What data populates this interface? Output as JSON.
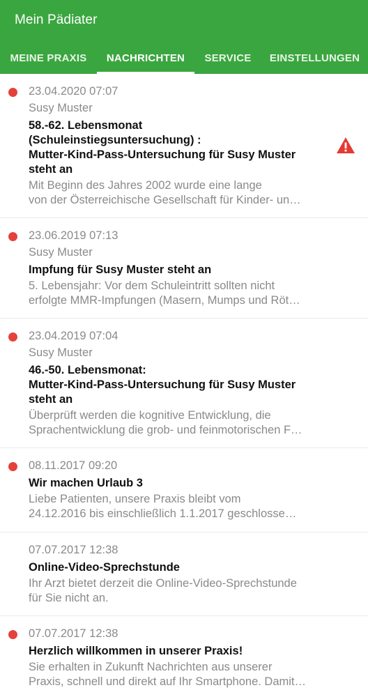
{
  "app": {
    "title": "Mein Pädiater"
  },
  "tabs": [
    {
      "label": "MEINE PRAXIS",
      "active": false
    },
    {
      "label": "NACHRICHTEN",
      "active": true
    },
    {
      "label": "SERVICE",
      "active": false
    },
    {
      "label": "EINSTELLUNGEN",
      "active": false
    }
  ],
  "colors": {
    "app_bar": "#3aa63f",
    "unread_dot": "#e5413c",
    "warning_icon": "#e53935"
  },
  "messages": [
    {
      "unread": true,
      "date": "23.04.2020 07:07",
      "sender": "Susy Muster",
      "subject": [
        "58.-62. Lebensmonat",
        "(Schuleinstiegsuntersuchung)  :",
        "Mutter-Kind-Pass-Untersuchung für Susy Muster",
        "steht an"
      ],
      "preview": [
        "Mit Beginn des Jahres 2002 wurde eine lange",
        "von der Österreichische Gesellschaft für Kinder- un…"
      ],
      "icon": "warning-icon"
    },
    {
      "unread": true,
      "date": "23.06.2019 07:13",
      "sender": "Susy Muster",
      "subject": [
        "Impfung für Susy Muster steht an"
      ],
      "preview": [
        "5. Lebensjahr: Vor dem Schuleintritt sollten nicht",
        "erfolgte MMR-Impfungen (Masern, Mumps und Röt…"
      ]
    },
    {
      "unread": true,
      "date": "23.04.2019 07:04",
      "sender": "Susy Muster",
      "subject": [
        "46.-50. Lebensmonat:",
        "Mutter-Kind-Pass-Untersuchung für Susy Muster",
        "steht an"
      ],
      "preview": [
        "Überprüft werden die kognitive Entwicklung, die",
        "Sprachentwicklung die grob- und feinmotorischen F…"
      ]
    },
    {
      "unread": true,
      "date": "08.11.2017 09:20",
      "subject": [
        "Wir machen Urlaub 3"
      ],
      "preview": [
        "Liebe Patienten, unsere Praxis bleibt vom",
        "24.12.2016 bis einschließlich 1.1.2017 geschlosse…"
      ]
    },
    {
      "unread": false,
      "date": "07.07.2017 12:38",
      "subject": [
        "Online-Video-Sprechstunde"
      ],
      "preview": [
        "Ihr Arzt bietet derzeit die Online-Video-Sprechstunde",
        "für Sie nicht an."
      ]
    },
    {
      "unread": true,
      "date": "07.07.2017 12:38",
      "subject": [
        "Herzlich willkommen in unserer Praxis!"
      ],
      "preview": [
        "Sie erhalten in Zukunft Nachrichten aus unserer",
        "Praxis, schnell und direkt auf Ihr Smartphone. Damit…"
      ]
    }
  ]
}
